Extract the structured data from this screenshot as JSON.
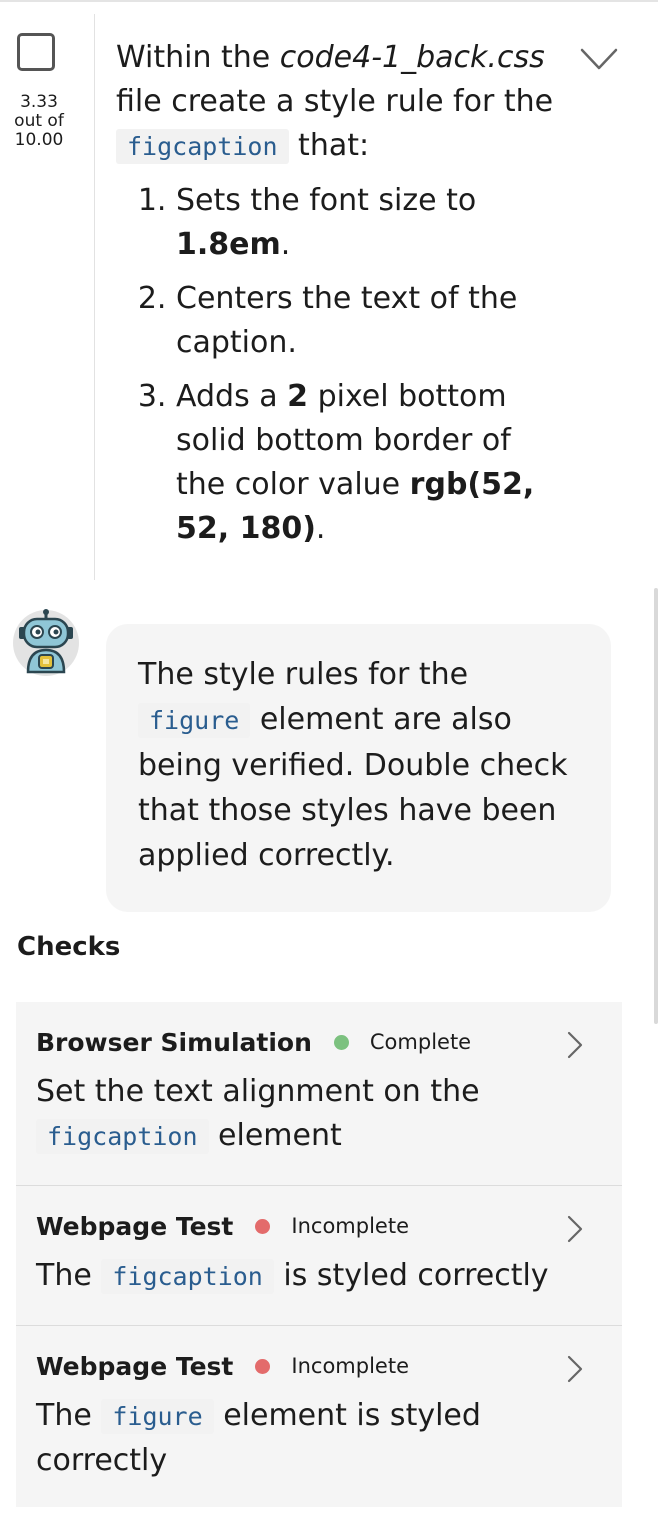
{
  "task": {
    "score_value": "3.33",
    "score_sep": "out of",
    "score_total": "10.00",
    "intro_1": "Within the ",
    "filename": "code4-1_back.css",
    "intro_2": " file create a style rule for the ",
    "element": "figcaption",
    "intro_3": " that:",
    "steps": [
      {
        "pre": "Sets the font size to ",
        "bold": "1.8em",
        "post": "."
      },
      {
        "pre": "Centers the text of the caption.",
        "bold": "",
        "post": ""
      },
      {
        "pre": "Adds a ",
        "bold": "2",
        "post": " pixel bottom solid bottom border of the color value ",
        "bold2": "rgb(52, 52, 180)",
        "post2": "."
      }
    ]
  },
  "hint": {
    "text_1": "The style rules for the ",
    "code": "figure",
    "text_2": " element are also being verified. Double check that those styles have been applied correctly."
  },
  "checks": {
    "title": "Checks",
    "items": [
      {
        "type": "Browser Simulation",
        "status": "Complete",
        "status_color": "#7cc17f",
        "desc_pre": "Set the text alignment on the ",
        "desc_code": "figcaption",
        "desc_post": " element"
      },
      {
        "type": "Webpage Test",
        "status": "Incomplete",
        "status_color": "#e36b6b",
        "desc_pre": "The ",
        "desc_code": "figcaption",
        "desc_post": " is styled correctly"
      },
      {
        "type": "Webpage Test",
        "status": "Incomplete",
        "status_color": "#e36b6b",
        "desc_pre": "The ",
        "desc_code": "figure",
        "desc_post": " element is styled correctly"
      }
    ]
  },
  "icons": {
    "checkbox": "checkbox-unchecked-icon",
    "expand": "chevron-down-icon",
    "hint_avatar": "robot-icon",
    "open_check": "chevron-right-icon"
  }
}
